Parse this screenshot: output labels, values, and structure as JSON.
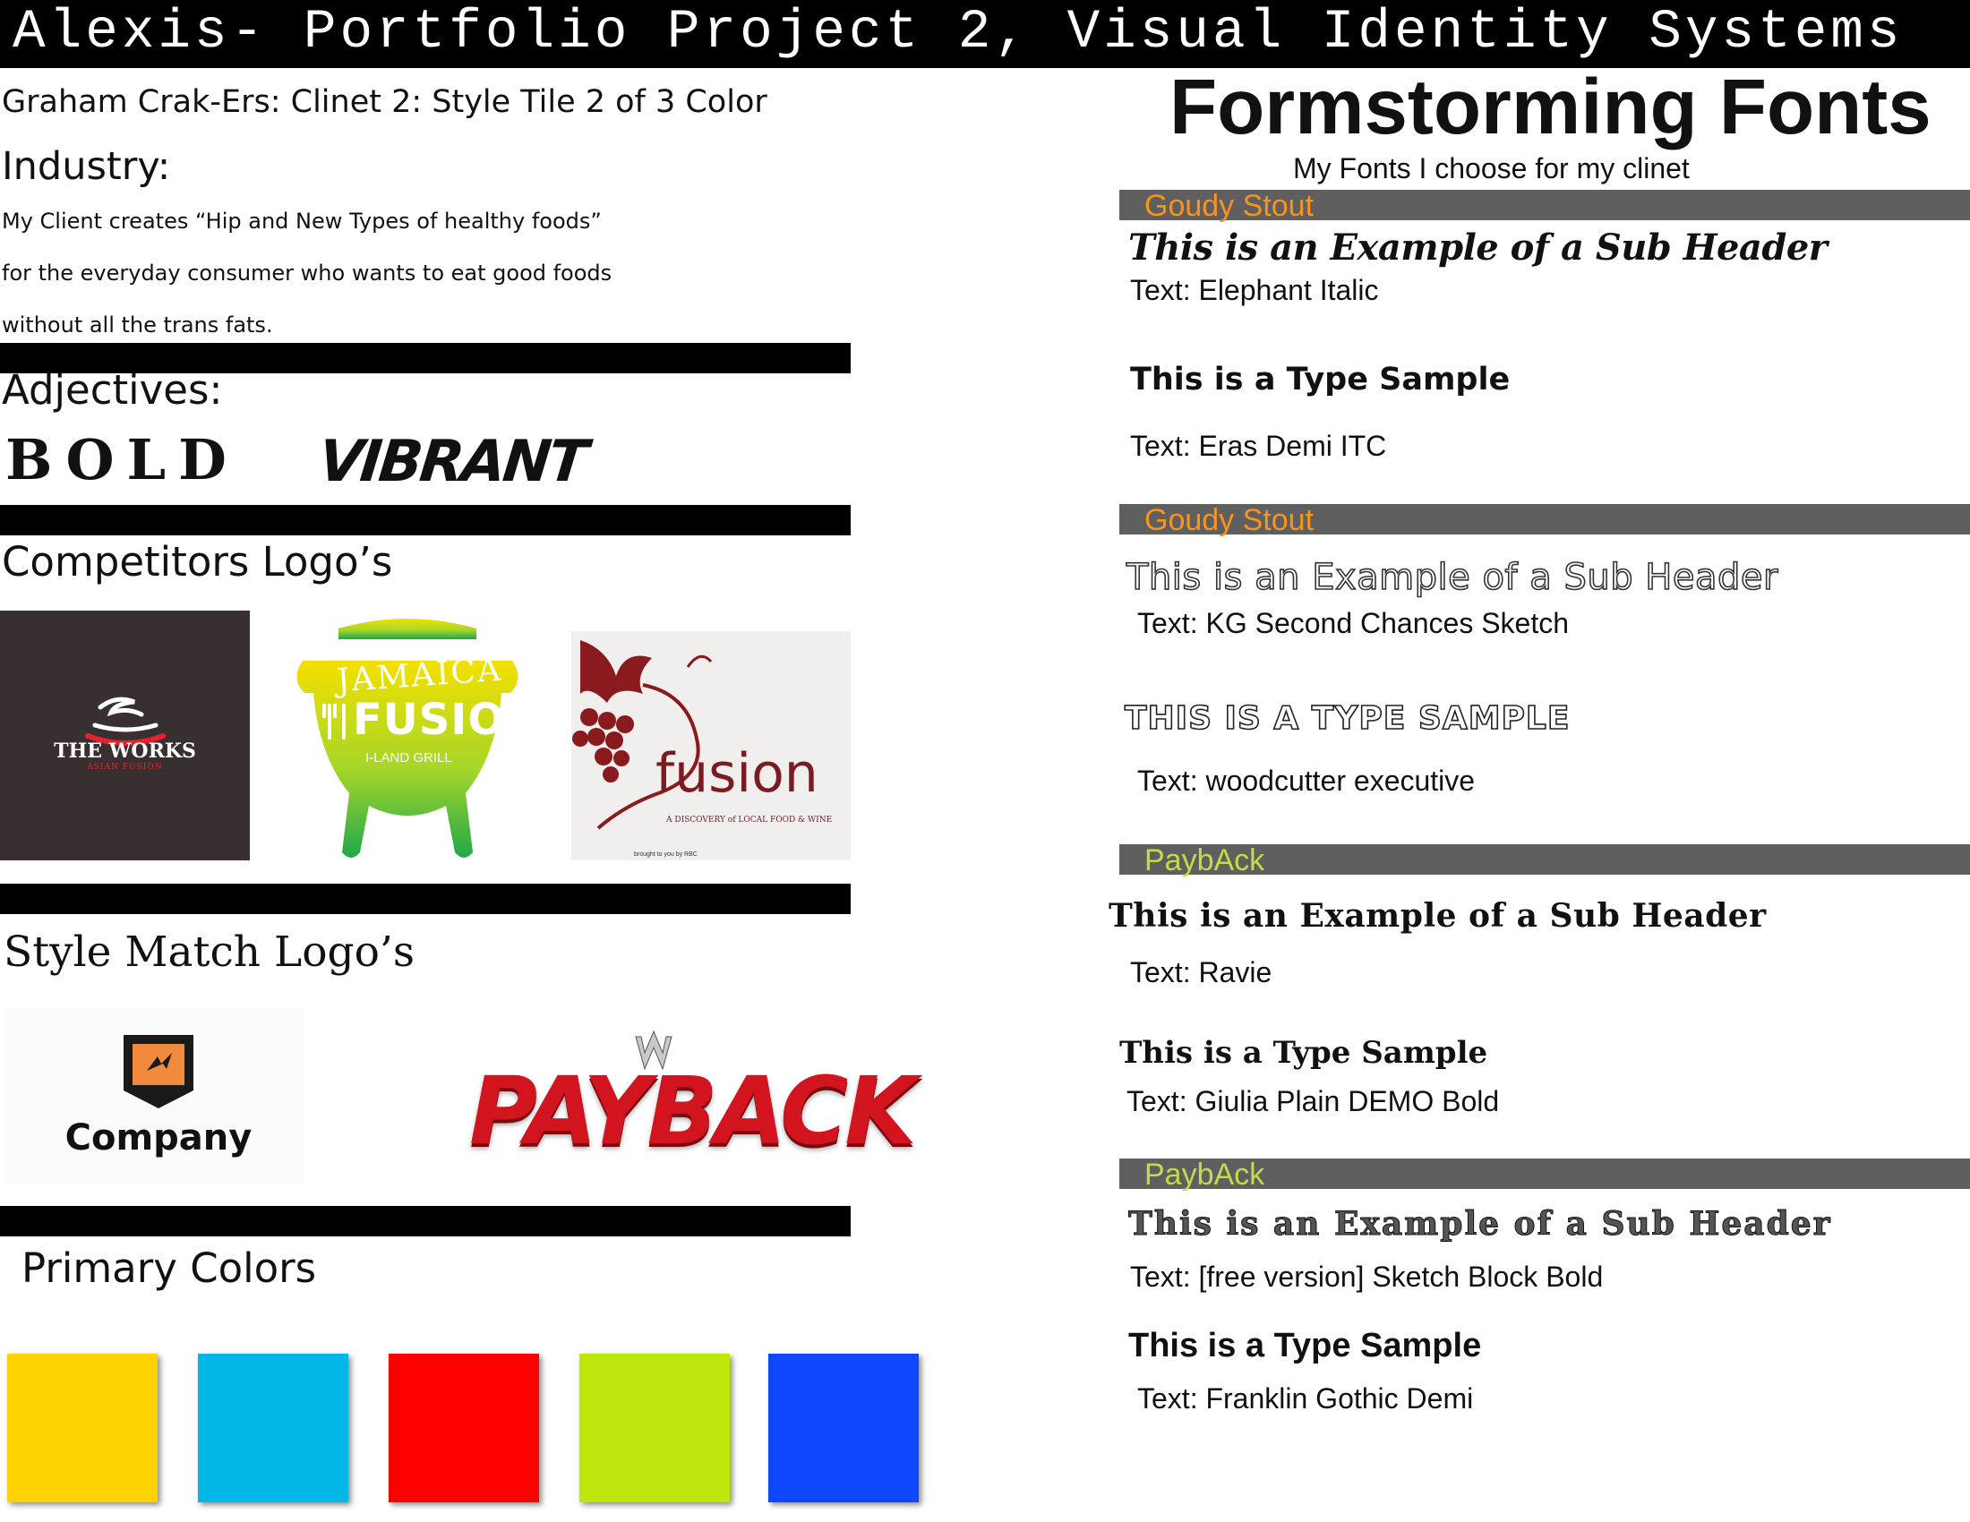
{
  "header": {
    "title": "Alexis- Portfolio Project 2, Visual Identity Systems"
  },
  "left": {
    "subtitle": "Graham Crak-Ers: Clinet 2: Style Tile 2 of 3 Color",
    "industry_heading": "Industry:",
    "industry_lines": [
      "My Client creates “Hip and New Types of healthy foods”",
      "for the everyday consumer who wants to eat good foods",
      "without all the trans fats."
    ],
    "adjectives_heading": "Adjectives:",
    "adjectives": [
      "BOLD",
      "VIBRANT"
    ],
    "competitors_heading": "Competitors Logo’s",
    "competitor_logos": {
      "works": {
        "name": "THE WORKS",
        "tagline": "ASIAN FUSION"
      },
      "jamaica": {
        "line1": "JAMAICA",
        "line2": "FUSION",
        "tagline": "I-LAND GRILL"
      },
      "fusion": {
        "name": "fusion",
        "tagline": "A DISCOVERY of LOCAL FOOD & WINE",
        "credit": "brought to you by RBC"
      }
    },
    "style_match_heading": "Style Match Logo’s",
    "style_logos": {
      "company": {
        "name": "Company"
      },
      "payback": {
        "name": "PAYBACK",
        "badge": "W"
      }
    },
    "colors_heading": "Primary Colors",
    "colors": [
      "#ffd300",
      "#00b7e7",
      "#ff0000",
      "#bde60a",
      "#0f47ff"
    ]
  },
  "right": {
    "heading": "Formstorming Fonts",
    "subheading": "My Fonts I choose for my clinet",
    "sections": [
      {
        "bar_label": "Goudy Stout",
        "sub_header": "This is an Example of a Sub Header",
        "sub_header_font": "Text: Elephant Italic",
        "type_sample": "This is a Type Sample",
        "type_sample_font": "Text: Eras Demi ITC"
      },
      {
        "bar_label": "Goudy Stout",
        "sub_header": "This is an Example of a Sub Header",
        "sub_header_font": "Text: KG Second Chances Sketch",
        "type_sample": "THIS IS A TYPE SAMPLE",
        "type_sample_font": "Text: woodcutter executive"
      },
      {
        "bar_label": "PaybAck",
        "sub_header": "This is an Example of a Sub Header",
        "sub_header_font": "Text: Ravie",
        "type_sample": "This is a Type Sample",
        "type_sample_font": "Text: Giulia Plain DEMO Bold"
      },
      {
        "bar_label": "PaybAck",
        "sub_header": "This is an Example of a Sub Header",
        "sub_header_font": "Text: [free version] Sketch Block Bold",
        "type_sample": "This is a Type Sample",
        "type_sample_font": "Text: Franklin Gothic Demi"
      }
    ],
    "bar_label_colors": [
      "#f7931e",
      "#f7931e",
      "#c6d94a",
      "#c6d94a"
    ]
  }
}
